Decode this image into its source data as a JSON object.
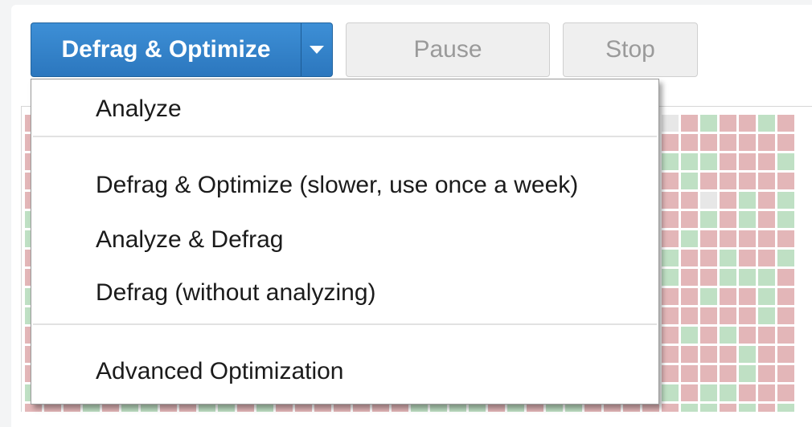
{
  "toolbar": {
    "main_action_label": "Defrag & Optimize",
    "pause_label": "Pause",
    "stop_label": "Stop"
  },
  "dropdown": {
    "items": [
      {
        "label": "Analyze"
      },
      {
        "label": "Defrag & Optimize (slower, use once a week)"
      },
      {
        "label": "Analyze & Defrag"
      },
      {
        "label": "Defrag (without analyzing)"
      },
      {
        "label": "Advanced Optimization"
      }
    ]
  },
  "colors": {
    "accent_blue": "#2c77be",
    "fragmented_block": "#e3b6b8",
    "contiguous_block": "#bfe0c4",
    "free_block": "#e7e7e7"
  }
}
